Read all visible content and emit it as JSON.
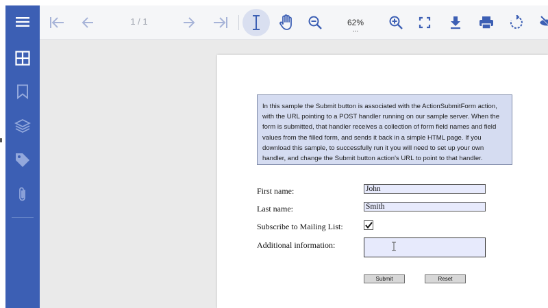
{
  "sidebar": {
    "items": [
      {
        "name": "menu"
      },
      {
        "name": "thumbnails"
      },
      {
        "name": "bookmarks"
      },
      {
        "name": "layers"
      },
      {
        "name": "tags"
      },
      {
        "name": "attachments"
      }
    ]
  },
  "toolbar": {
    "page_counter": "1 / 1",
    "zoom_value": "62%",
    "zoom_more": "..."
  },
  "document": {
    "info_text": "In this sample the Submit button is associated with the ActionSubmitForm action, with the URL pointing to a POST handler running on our sample server. When the form is submitted, that handler receives a collection of form field names and field values from the filled form, and sends it back in a simple HTML page. If you download this sample, to successfully run it you will need to set up your own handler, and change the Submit button action's URL to point to that handler.",
    "form": {
      "first_name_label": "First name:",
      "first_name_value": "John",
      "last_name_label": "Last name:",
      "last_name_value": "Smith",
      "subscribe_label": "Subscribe to Mailing List:",
      "subscribe_checked": true,
      "additional_label": "Additional information:",
      "additional_value": "",
      "submit_label": "Submit",
      "reset_label": "Reset"
    }
  },
  "colors": {
    "sidebar_bg": "#3c5fb4",
    "toolbar_icon": "#3c5fb4",
    "field_bg": "#e7eafc",
    "info_bg": "#d5dcf1"
  }
}
